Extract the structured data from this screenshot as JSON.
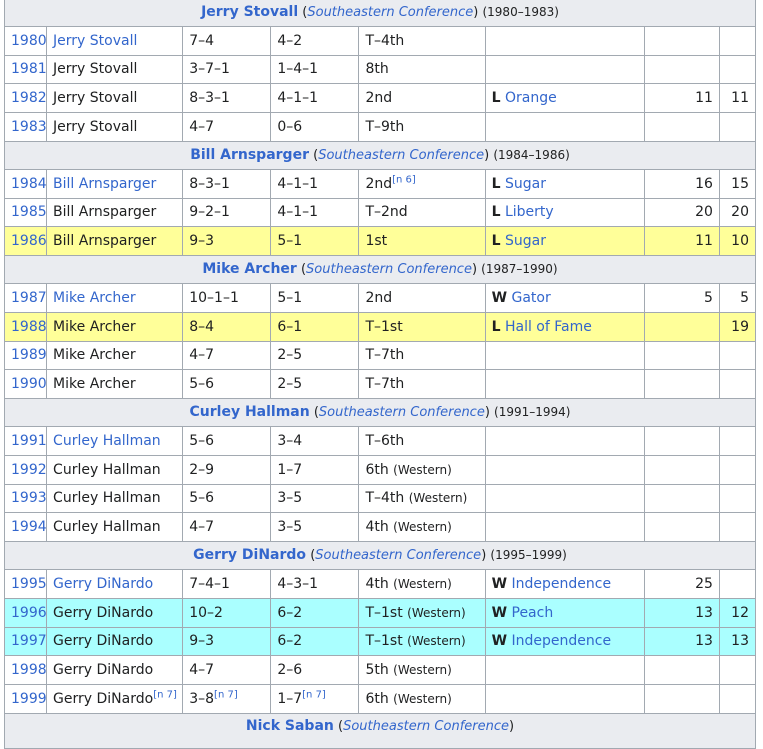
{
  "blocks": [
    {
      "coach": "Jerry Stovall",
      "conference": "Southeastern Conference",
      "years": "(1980–1983)",
      "rows": [
        {
          "year": "1980",
          "coach": "Jerry Stovall",
          "coach_link": true,
          "overall": "7–4",
          "conf": "4–2",
          "standing": "T–4th",
          "division": "",
          "bowl_result": "",
          "bowl": "",
          "coaches": "",
          "ap": "",
          "hl": ""
        },
        {
          "year": "1981",
          "coach": "Jerry Stovall",
          "coach_link": false,
          "overall": "3–7–1",
          "conf": "1–4–1",
          "standing": "8th",
          "division": "",
          "bowl_result": "",
          "bowl": "",
          "coaches": "",
          "ap": "",
          "hl": ""
        },
        {
          "year": "1982",
          "coach": "Jerry Stovall",
          "coach_link": false,
          "overall": "8–3–1",
          "conf": "4–1–1",
          "standing": "2nd",
          "division": "",
          "bowl_result": "L",
          "bowl": "Orange",
          "coaches": "11",
          "ap": "11",
          "hl": ""
        },
        {
          "year": "1983",
          "coach": "Jerry Stovall",
          "coach_link": false,
          "overall": "4–7",
          "conf": "0–6",
          "standing": "T–9th",
          "division": "",
          "bowl_result": "",
          "bowl": "",
          "coaches": "",
          "ap": "",
          "hl": ""
        }
      ]
    },
    {
      "coach": "Bill Arnsparger",
      "conference": "Southeastern Conference",
      "years": "(1984–1986)",
      "rows": [
        {
          "year": "1984",
          "coach": "Bill Arnsparger",
          "coach_link": true,
          "overall": "8–3–1",
          "conf": "4–1–1",
          "standing": "2nd",
          "standing_note": "[n 6]",
          "division": "",
          "bowl_result": "L",
          "bowl": "Sugar",
          "coaches": "16",
          "ap": "15",
          "hl": ""
        },
        {
          "year": "1985",
          "coach": "Bill Arnsparger",
          "coach_link": false,
          "overall": "9–2–1",
          "conf": "4–1–1",
          "standing": "T–2nd",
          "division": "",
          "bowl_result": "L",
          "bowl": "Liberty",
          "coaches": "20",
          "ap": "20",
          "hl": ""
        },
        {
          "year": "1986",
          "coach": "Bill Arnsparger",
          "coach_link": false,
          "overall": "9–3",
          "conf": "5–1",
          "standing": "1st",
          "division": "",
          "bowl_result": "L",
          "bowl": "Sugar",
          "coaches": "11",
          "ap": "10",
          "hl": "yellow"
        }
      ]
    },
    {
      "coach": "Mike Archer",
      "conference": "Southeastern Conference",
      "years": "(1987–1990)",
      "rows": [
        {
          "year": "1987",
          "coach": "Mike Archer",
          "coach_link": true,
          "overall": "10–1–1",
          "conf": "5–1",
          "standing": "2nd",
          "division": "",
          "bowl_result": "W",
          "bowl": "Gator",
          "coaches": "5",
          "ap": "5",
          "hl": ""
        },
        {
          "year": "1988",
          "coach": "Mike Archer",
          "coach_link": false,
          "overall": "8–4",
          "conf": "6–1",
          "standing": "T–1st",
          "division": "",
          "bowl_result": "L",
          "bowl": "Hall of Fame",
          "coaches": "",
          "ap": "19",
          "hl": "yellow"
        },
        {
          "year": "1989",
          "coach": "Mike Archer",
          "coach_link": false,
          "overall": "4–7",
          "conf": "2–5",
          "standing": "T–7th",
          "division": "",
          "bowl_result": "",
          "bowl": "",
          "coaches": "",
          "ap": "",
          "hl": ""
        },
        {
          "year": "1990",
          "coach": "Mike Archer",
          "coach_link": false,
          "overall": "5–6",
          "conf": "2–5",
          "standing": "T–7th",
          "division": "",
          "bowl_result": "",
          "bowl": "",
          "coaches": "",
          "ap": "",
          "hl": ""
        }
      ]
    },
    {
      "coach": "Curley Hallman",
      "conference": "Southeastern Conference",
      "years": "(1991–1994)",
      "rows": [
        {
          "year": "1991",
          "coach": "Curley Hallman",
          "coach_link": true,
          "overall": "5–6",
          "conf": "3–4",
          "standing": "T–6th",
          "division": "",
          "bowl_result": "",
          "bowl": "",
          "coaches": "",
          "ap": "",
          "hl": ""
        },
        {
          "year": "1992",
          "coach": "Curley Hallman",
          "coach_link": false,
          "overall": "2–9",
          "conf": "1–7",
          "standing": "6th",
          "division": "(Western)",
          "bowl_result": "",
          "bowl": "",
          "coaches": "",
          "ap": "",
          "hl": ""
        },
        {
          "year": "1993",
          "coach": "Curley Hallman",
          "coach_link": false,
          "overall": "5–6",
          "conf": "3–5",
          "standing": "T–4th",
          "division": "(Western)",
          "bowl_result": "",
          "bowl": "",
          "coaches": "",
          "ap": "",
          "hl": ""
        },
        {
          "year": "1994",
          "coach": "Curley Hallman",
          "coach_link": false,
          "overall": "4–7",
          "conf": "3–5",
          "standing": "4th",
          "division": "(Western)",
          "bowl_result": "",
          "bowl": "",
          "coaches": "",
          "ap": "",
          "hl": ""
        }
      ]
    },
    {
      "coach": "Gerry DiNardo",
      "conference": "Southeastern Conference",
      "years": "(1995–1999)",
      "rows": [
        {
          "year": "1995",
          "coach": "Gerry DiNardo",
          "coach_link": true,
          "overall": "7–4–1",
          "conf": "4–3–1",
          "standing": "4th",
          "division": "(Western)",
          "bowl_result": "W",
          "bowl": "Independence",
          "coaches": "25",
          "ap": "",
          "hl": ""
        },
        {
          "year": "1996",
          "coach": "Gerry DiNardo",
          "coach_link": false,
          "overall": "10–2",
          "conf": "6–2",
          "standing": "T–1st",
          "division": "(Western)",
          "bowl_result": "W",
          "bowl": "Peach",
          "coaches": "13",
          "ap": "12",
          "hl": "cyan"
        },
        {
          "year": "1997",
          "coach": "Gerry DiNardo",
          "coach_link": false,
          "overall": "9–3",
          "conf": "6–2",
          "standing": "T–1st",
          "division": "(Western)",
          "bowl_result": "W",
          "bowl": "Independence",
          "coaches": "13",
          "ap": "13",
          "hl": "cyan"
        },
        {
          "year": "1998",
          "coach": "Gerry DiNardo",
          "coach_link": false,
          "overall": "4–7",
          "conf": "2–6",
          "standing": "5th",
          "division": "(Western)",
          "bowl_result": "",
          "bowl": "",
          "coaches": "",
          "ap": "",
          "hl": ""
        },
        {
          "year": "1999",
          "coach": "Gerry DiNardo",
          "coach_link": false,
          "coach_note": "[n 7]",
          "overall": "3–8",
          "overall_note": "[n 7]",
          "conf": "1–7",
          "conf_note": "[n 7]",
          "standing": "6th",
          "division": "(Western)",
          "bowl_result": "",
          "bowl": "",
          "coaches": "",
          "ap": "",
          "hl": ""
        }
      ]
    }
  ],
  "partial_block": {
    "coach": "Nick Saban",
    "conference": "Southeastern Conference"
  },
  "colors": {
    "link": "#3366cc",
    "header_bg": "#eaecf0",
    "border": "#a2a9b1",
    "highlight_conference_title": "#ffff99",
    "highlight_division_title": "#aaffff"
  }
}
